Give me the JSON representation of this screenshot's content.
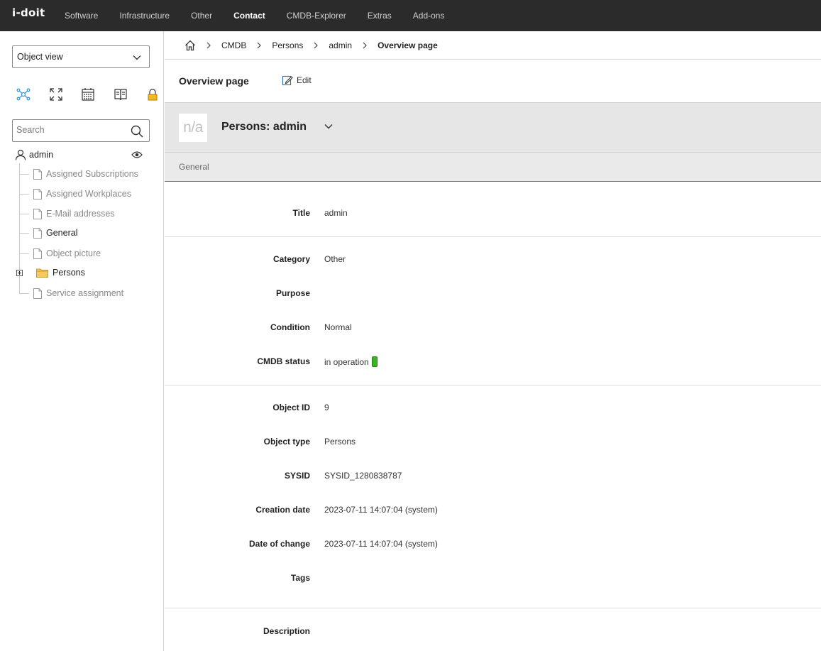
{
  "app": {
    "logo": "i-doit",
    "nav": [
      "Software",
      "Infrastructure",
      "Other",
      "Contact",
      "CMDB-Explorer",
      "Extras",
      "Add-ons"
    ],
    "active_nav": "Contact"
  },
  "sidebar": {
    "view_select": "Object view",
    "search_placeholder": "Search",
    "tree_root": "admin",
    "items": [
      {
        "label": "Assigned Subscriptions",
        "dim": true
      },
      {
        "label": "Assigned Workplaces",
        "dim": true
      },
      {
        "label": "E-Mail addresses",
        "dim": true
      },
      {
        "label": "General",
        "dim": false
      },
      {
        "label": "Object picture",
        "dim": true
      },
      {
        "label": "Persons",
        "dim": false
      },
      {
        "label": "Service assignment",
        "dim": true
      }
    ]
  },
  "breadcrumb": [
    "CMDB",
    "Persons",
    "admin",
    "Overview page"
  ],
  "page": {
    "title": "Overview page",
    "edit_label": "Edit",
    "object_image_placeholder": "n/a",
    "object_title": "Persons: admin",
    "section": "General"
  },
  "fields": {
    "title": {
      "label": "Title",
      "value": "admin"
    },
    "category": {
      "label": "Category",
      "value": "Other"
    },
    "purpose": {
      "label": "Purpose",
      "value": ""
    },
    "condition": {
      "label": "Condition",
      "value": "Normal"
    },
    "cmdb_status": {
      "label": "CMDB status",
      "value": "in operation",
      "color": "#3cb324"
    },
    "object_id": {
      "label": "Object ID",
      "value": "9"
    },
    "object_type": {
      "label": "Object type",
      "value": "Persons"
    },
    "sysid": {
      "label": "SYSID",
      "value": "SYSID_1280838787"
    },
    "creation_date": {
      "label": "Creation date",
      "value": "2023-07-11 14:07:04 (system)"
    },
    "date_of_change": {
      "label": "Date of change",
      "value": "2023-07-11 14:07:04 (system)"
    },
    "tags": {
      "label": "Tags",
      "value": ""
    },
    "description": {
      "label": "Description",
      "value": ""
    }
  },
  "icons": {
    "home": "home-icon",
    "edit": "pencil-icon",
    "search": "search-icon",
    "eye": "eye-icon",
    "user": "user-icon",
    "folder": "folder-icon",
    "file": "file-icon"
  }
}
